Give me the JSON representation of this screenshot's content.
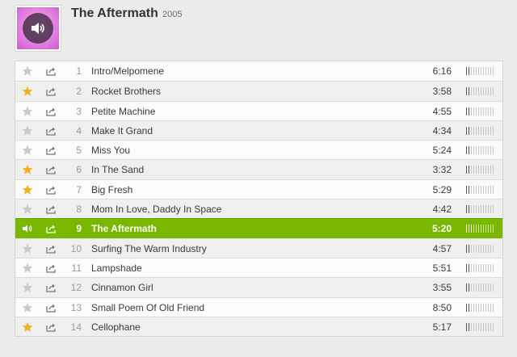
{
  "album": {
    "title": "The Aftermath",
    "year": "2005",
    "cover_icon": "speaker-icon"
  },
  "colors": {
    "playing_row": "#79b700",
    "star_on": "#f2b21d",
    "star_off": "#c9c9c9"
  },
  "tracks": [
    {
      "number": "1",
      "name": "Intro/Melpomene",
      "duration": "6:16",
      "starred": false,
      "popularity": 0.2,
      "playing": false
    },
    {
      "number": "2",
      "name": "Rocket Brothers",
      "duration": "3:58",
      "starred": true,
      "popularity": 0.2,
      "playing": false
    },
    {
      "number": "3",
      "name": "Petite Machine",
      "duration": "4:55",
      "starred": false,
      "popularity": 0.2,
      "playing": false
    },
    {
      "number": "4",
      "name": "Make It Grand",
      "duration": "4:34",
      "starred": false,
      "popularity": 0.2,
      "playing": false
    },
    {
      "number": "5",
      "name": "Miss You",
      "duration": "5:24",
      "starred": false,
      "popularity": 0.2,
      "playing": false
    },
    {
      "number": "6",
      "name": "In The Sand",
      "duration": "3:32",
      "starred": true,
      "popularity": 0.2,
      "playing": false
    },
    {
      "number": "7",
      "name": "Big Fresh",
      "duration": "5:29",
      "starred": true,
      "popularity": 0.2,
      "playing": false
    },
    {
      "number": "8",
      "name": "Mom In Love, Daddy In Space",
      "duration": "4:42",
      "starred": false,
      "popularity": 0.2,
      "playing": false
    },
    {
      "number": "9",
      "name": "The Aftermath",
      "duration": "5:20",
      "starred": false,
      "popularity": 0.25,
      "playing": true
    },
    {
      "number": "10",
      "name": "Surfing The Warm Industry",
      "duration": "4:57",
      "starred": false,
      "popularity": 0.2,
      "playing": false
    },
    {
      "number": "11",
      "name": "Lampshade",
      "duration": "5:51",
      "starred": false,
      "popularity": 0.2,
      "playing": false
    },
    {
      "number": "12",
      "name": "Cinnamon Girl",
      "duration": "3:55",
      "starred": false,
      "popularity": 0.2,
      "playing": false
    },
    {
      "number": "13",
      "name": "Small Poem Of Old Friend",
      "duration": "8:50",
      "starred": false,
      "popularity": 0.2,
      "playing": false
    },
    {
      "number": "14",
      "name": "Cellophane",
      "duration": "5:17",
      "starred": true,
      "popularity": 0.2,
      "playing": false
    }
  ]
}
